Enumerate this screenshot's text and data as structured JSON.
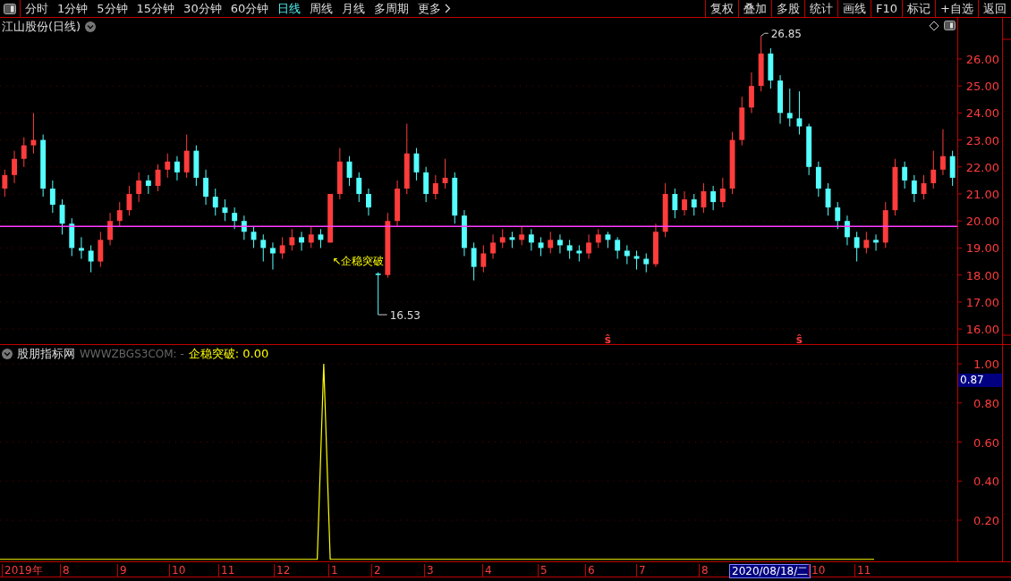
{
  "toolbar": {
    "periods": [
      {
        "label": "分时",
        "selected": false
      },
      {
        "label": "1分钟",
        "selected": false
      },
      {
        "label": "5分钟",
        "selected": false
      },
      {
        "label": "15分钟",
        "selected": false
      },
      {
        "label": "30分钟",
        "selected": false
      },
      {
        "label": "60分钟",
        "selected": false
      },
      {
        "label": "日线",
        "selected": true
      },
      {
        "label": "周线",
        "selected": false
      },
      {
        "label": "月线",
        "selected": false
      },
      {
        "label": "多周期",
        "selected": false
      },
      {
        "label": "更多",
        "selected": false
      }
    ],
    "buttons": [
      "复权",
      "叠加",
      "多股",
      "统计",
      "画线",
      "F10",
      "标记",
      "+自选",
      "返回"
    ]
  },
  "price_pane": {
    "title": "江山股份(日线)",
    "signal_label": "↖企稳突破",
    "high_label": "26.85",
    "low_label": "16.53",
    "markers": [
      "ŝ",
      "ŝ"
    ],
    "chart_data": {
      "type": "candlestick",
      "grid": true,
      "ylim": [
        15.44,
        27.52
      ],
      "ref_lines": [
        {
          "axis": "y",
          "value": 19.8,
          "color": "#ff3cff"
        }
      ],
      "yticks": [
        {
          "value": 26,
          "label": "26.00"
        },
        {
          "value": 25,
          "label": "25.00"
        },
        {
          "value": 24,
          "label": "24.00"
        },
        {
          "value": 23,
          "label": "23.00"
        },
        {
          "value": 22,
          "label": "22.00"
        },
        {
          "value": 21,
          "label": "21.00"
        },
        {
          "value": 20,
          "label": "20.00"
        },
        {
          "value": 19,
          "label": "19.00"
        },
        {
          "value": 18,
          "label": "18.00"
        },
        {
          "value": 17,
          "label": "17.00"
        },
        {
          "value": 16,
          "label": "16.00"
        }
      ],
      "ohlc": [
        [
          21.2,
          21.9,
          20.9,
          21.7
        ],
        [
          21.7,
          22.6,
          21.4,
          22.3
        ],
        [
          22.3,
          23.1,
          22.0,
          22.8
        ],
        [
          22.8,
          24.0,
          22.5,
          23.0
        ],
        [
          23.0,
          23.2,
          20.9,
          21.2
        ],
        [
          21.2,
          21.5,
          20.3,
          20.6
        ],
        [
          20.6,
          20.8,
          19.5,
          19.9
        ],
        [
          19.9,
          20.1,
          18.7,
          19.0
        ],
        [
          19.0,
          19.4,
          18.6,
          18.9
        ],
        [
          18.9,
          19.1,
          18.1,
          18.5
        ],
        [
          18.5,
          19.6,
          18.3,
          19.3
        ],
        [
          19.3,
          20.3,
          19.1,
          20.0
        ],
        [
          20.0,
          20.7,
          19.8,
          20.4
        ],
        [
          20.4,
          21.3,
          20.2,
          21.0
        ],
        [
          21.0,
          21.8,
          20.7,
          21.5
        ],
        [
          21.5,
          21.7,
          21.0,
          21.3
        ],
        [
          21.3,
          22.1,
          21.1,
          21.9
        ],
        [
          21.9,
          22.5,
          21.6,
          22.2
        ],
        [
          22.2,
          22.4,
          21.5,
          21.8
        ],
        [
          21.8,
          23.2,
          21.6,
          22.6
        ],
        [
          22.6,
          22.8,
          21.3,
          21.6
        ],
        [
          21.6,
          21.9,
          20.6,
          20.9
        ],
        [
          20.9,
          21.2,
          20.2,
          20.5
        ],
        [
          20.5,
          20.8,
          20.0,
          20.3
        ],
        [
          20.3,
          20.5,
          19.7,
          20.0
        ],
        [
          20.0,
          20.2,
          19.3,
          19.6
        ],
        [
          19.6,
          19.8,
          19.0,
          19.3
        ],
        [
          19.3,
          19.5,
          18.5,
          19.0
        ],
        [
          19.0,
          19.2,
          18.2,
          18.8
        ],
        [
          18.8,
          19.4,
          18.6,
          19.1
        ],
        [
          19.1,
          19.7,
          18.9,
          19.4
        ],
        [
          19.4,
          19.6,
          18.9,
          19.2
        ],
        [
          19.2,
          19.8,
          19.0,
          19.5
        ],
        [
          19.5,
          19.7,
          19.0,
          19.3
        ],
        [
          19.2,
          21.0,
          19.2,
          21.0
        ],
        [
          21.0,
          22.7,
          20.8,
          22.2
        ],
        [
          22.2,
          22.4,
          21.3,
          21.6
        ],
        [
          21.6,
          21.8,
          20.7,
          21.0
        ],
        [
          21.0,
          21.2,
          20.2,
          20.5
        ],
        [
          18.05,
          18.1,
          16.53,
          18.0
        ],
        [
          18.0,
          20.3,
          17.9,
          20.0
        ],
        [
          20.0,
          21.5,
          19.8,
          21.2
        ],
        [
          21.2,
          23.6,
          21.0,
          22.5
        ],
        [
          22.5,
          22.7,
          21.5,
          21.8
        ],
        [
          21.8,
          22.0,
          20.7,
          21.0
        ],
        [
          21.0,
          21.7,
          20.8,
          21.4
        ],
        [
          21.4,
          22.3,
          21.2,
          21.6
        ],
        [
          21.6,
          21.8,
          19.9,
          20.2
        ],
        [
          20.2,
          20.4,
          18.7,
          19.0
        ],
        [
          19.0,
          19.2,
          17.8,
          18.3
        ],
        [
          18.3,
          19.1,
          18.1,
          18.8
        ],
        [
          18.8,
          19.5,
          18.6,
          19.2
        ],
        [
          19.2,
          19.7,
          19.0,
          19.4
        ],
        [
          19.4,
          19.6,
          19.0,
          19.3
        ],
        [
          19.3,
          19.8,
          19.1,
          19.5
        ],
        [
          19.5,
          19.7,
          18.9,
          19.2
        ],
        [
          19.2,
          19.4,
          18.7,
          19.0
        ],
        [
          19.0,
          19.6,
          18.8,
          19.3
        ],
        [
          19.3,
          19.5,
          18.8,
          19.1
        ],
        [
          19.1,
          19.3,
          18.6,
          18.9
        ],
        [
          18.9,
          19.1,
          18.5,
          18.8
        ],
        [
          18.8,
          19.5,
          18.6,
          19.2
        ],
        [
          19.2,
          19.7,
          19.0,
          19.5
        ],
        [
          19.5,
          19.6,
          19.0,
          19.3
        ],
        [
          19.3,
          19.4,
          18.6,
          18.9
        ],
        [
          18.9,
          19.1,
          18.4,
          18.7
        ],
        [
          18.7,
          18.9,
          18.2,
          18.6
        ],
        [
          18.6,
          18.8,
          18.1,
          18.4
        ],
        [
          18.4,
          19.9,
          18.3,
          19.6
        ],
        [
          19.6,
          21.4,
          19.4,
          21.0
        ],
        [
          21.0,
          21.2,
          20.1,
          20.4
        ],
        [
          20.4,
          21.1,
          20.2,
          20.8
        ],
        [
          20.8,
          21.0,
          20.2,
          20.5
        ],
        [
          20.5,
          21.4,
          20.3,
          21.1
        ],
        [
          21.1,
          21.3,
          20.4,
          20.7
        ],
        [
          20.7,
          21.6,
          20.5,
          21.2
        ],
        [
          21.2,
          23.3,
          21.0,
          23.0
        ],
        [
          23.0,
          24.6,
          22.8,
          24.2
        ],
        [
          24.2,
          25.5,
          24.0,
          25.0
        ],
        [
          25.0,
          26.85,
          24.8,
          26.2
        ],
        [
          26.2,
          26.4,
          24.9,
          25.2
        ],
        [
          25.2,
          25.4,
          23.6,
          24.0
        ],
        [
          24.0,
          24.9,
          23.5,
          23.8
        ],
        [
          23.8,
          24.8,
          23.2,
          23.5
        ],
        [
          23.5,
          23.6,
          21.7,
          22.0
        ],
        [
          22.0,
          22.2,
          20.9,
          21.2
        ],
        [
          21.2,
          21.4,
          20.2,
          20.5
        ],
        [
          20.5,
          20.7,
          19.7,
          20.0
        ],
        [
          20.0,
          20.2,
          19.1,
          19.4
        ],
        [
          19.4,
          19.6,
          18.5,
          19.0
        ],
        [
          19.0,
          19.6,
          18.8,
          19.3
        ],
        [
          19.3,
          19.5,
          18.9,
          19.2
        ],
        [
          19.2,
          20.7,
          19.0,
          20.4
        ],
        [
          20.4,
          22.3,
          20.2,
          22.0
        ],
        [
          22.0,
          22.2,
          21.2,
          21.5
        ],
        [
          21.5,
          21.7,
          20.7,
          21.0
        ],
        [
          21.0,
          21.7,
          20.8,
          21.4
        ],
        [
          21.4,
          22.6,
          21.2,
          21.9
        ],
        [
          21.9,
          23.4,
          21.7,
          22.4
        ],
        [
          22.4,
          22.6,
          21.3,
          21.6
        ]
      ]
    }
  },
  "indicator_pane": {
    "name": "股朋指标网",
    "source": "WWWZBGS3COM: -",
    "reading": ": 0.00",
    "cursor_value": "0.87",
    "chart_data": {
      "type": "line",
      "grid": true,
      "ylim": [
        0,
        1.0
      ],
      "yticks": [
        {
          "value": 0.2,
          "label": "0.20"
        },
        {
          "value": 0.4,
          "label": "0.40"
        },
        {
          "value": 0.6,
          "label": "0.60"
        },
        {
          "value": 0.8,
          "label": "0.80"
        },
        {
          "value": 1.0,
          "label": "1.00"
        }
      ],
      "series": [
        {
          "name": "企稳突破",
          "color": "#ffff00",
          "values": [
            0,
            0,
            0,
            0,
            0,
            0,
            0,
            0,
            0,
            0,
            0,
            0,
            0,
            0,
            0,
            0,
            0,
            0,
            0,
            0,
            0,
            0,
            0,
            0,
            0,
            0,
            0,
            0,
            0,
            0,
            0,
            0,
            0,
            0,
            0,
            0,
            0,
            0,
            0,
            0,
            0,
            0,
            0,
            0,
            0,
            0,
            0,
            0,
            0,
            0,
            1,
            0,
            0,
            0,
            0,
            0,
            0,
            0,
            0,
            0,
            0,
            0,
            0,
            0,
            0,
            0,
            0,
            0,
            0,
            0,
            0,
            0,
            0,
            0,
            0,
            0,
            0,
            0,
            0,
            0,
            0,
            0,
            0,
            0,
            0,
            0,
            0,
            0,
            0,
            0,
            0,
            0,
            0,
            0,
            0,
            0,
            0,
            0,
            0,
            0,
            0,
            0,
            0,
            0,
            0,
            0,
            0,
            0,
            0,
            0,
            0,
            0,
            0,
            0,
            0,
            0,
            0,
            0,
            0,
            0,
            0,
            0,
            0,
            0,
            0,
            0,
            0,
            0,
            0,
            0,
            0,
            0,
            0,
            0,
            0,
            0
          ]
        }
      ]
    }
  },
  "date_axis": [
    {
      "label": "2019年",
      "selected": false
    },
    {
      "label": "8",
      "selected": false
    },
    {
      "label": "9",
      "selected": false
    },
    {
      "label": "10",
      "selected": false
    },
    {
      "label": "11",
      "selected": false
    },
    {
      "label": "12",
      "selected": false
    },
    {
      "label": "1",
      "selected": false
    },
    {
      "label": "2",
      "selected": false
    },
    {
      "label": "3",
      "selected": false
    },
    {
      "label": "4",
      "selected": false
    },
    {
      "label": "5",
      "selected": false
    },
    {
      "label": "6",
      "selected": false
    },
    {
      "label": "7",
      "selected": false
    },
    {
      "label": "8",
      "selected": false
    },
    {
      "label": "2020/08/18/二",
      "selected": true
    },
    {
      "label": "10",
      "selected": false
    },
    {
      "label": "11",
      "selected": false
    }
  ]
}
